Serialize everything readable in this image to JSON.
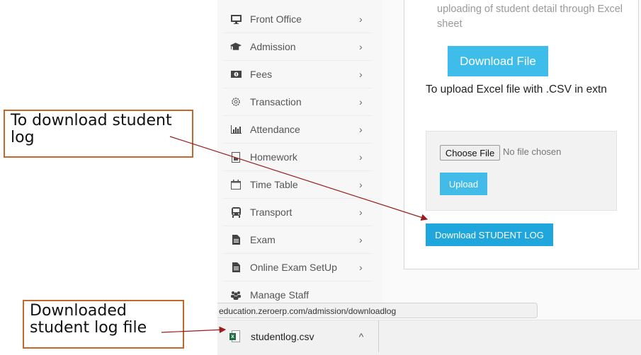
{
  "sidebar": {
    "items": [
      {
        "label": "Front Office",
        "icon": "desktop-icon"
      },
      {
        "label": "Admission",
        "icon": "graduation-cap-icon"
      },
      {
        "label": "Fees",
        "icon": "money-icon"
      },
      {
        "label": "Transaction",
        "icon": "gear-icon"
      },
      {
        "label": "Attendance",
        "icon": "bar-chart-icon"
      },
      {
        "label": "Homework",
        "icon": "document-icon"
      },
      {
        "label": "Time Table",
        "icon": "calendar-icon"
      },
      {
        "label": "Transport",
        "icon": "bus-icon"
      },
      {
        "label": "Exam",
        "icon": "file-icon"
      },
      {
        "label": "Online Exam SetUp",
        "icon": "file-icon"
      },
      {
        "label": "Manage Staff",
        "icon": "users-icon"
      }
    ],
    "chevron": "›"
  },
  "content": {
    "description": "uploading of student detail through Excel sheet",
    "download_file_label": "Download File",
    "upload_note": "To upload Excel file with .CSV in extn",
    "choose_file_label": "Choose File",
    "no_file_text": "No file chosen",
    "upload_label": "Upload",
    "download_log_label": "Download STUDENT LOG"
  },
  "browser": {
    "status_url": "education.zeroerp.com/admission/downloadlog",
    "download_shelf": {
      "file_name": "studentlog.csv",
      "caret": "^"
    }
  },
  "annotations": {
    "callout_1": "To download student log",
    "callout_2": "Downloaded student log file",
    "arrow_color": "#9b1c1c",
    "box_color": "#c0692b"
  }
}
